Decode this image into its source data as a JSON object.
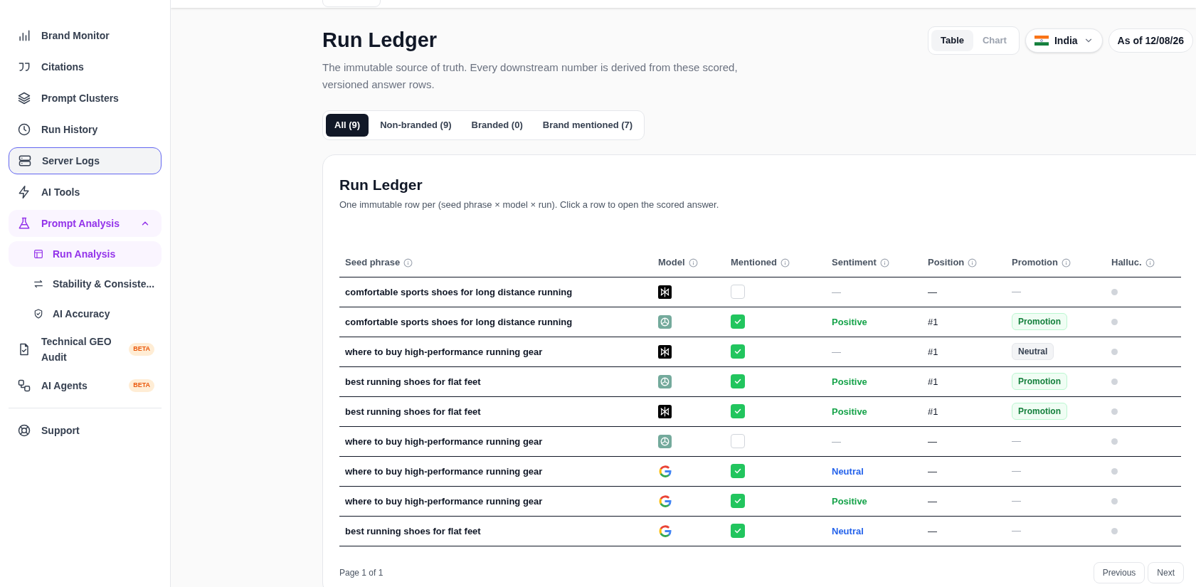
{
  "sidebar": {
    "items": [
      {
        "label": "Brand Monitor",
        "selected": false,
        "focused": false
      },
      {
        "label": "Citations",
        "selected": false,
        "focused": false
      },
      {
        "label": "Prompt Clusters",
        "selected": false,
        "focused": false
      },
      {
        "label": "Run History",
        "selected": false,
        "focused": false
      },
      {
        "label": "Server Logs",
        "selected": false,
        "focused": true
      },
      {
        "label": "AI Tools",
        "selected": false,
        "focused": false
      },
      {
        "label": "Prompt Analysis",
        "selected": true,
        "focused": false,
        "expanded": true,
        "children": [
          {
            "label": "Run Analysis",
            "selected": true
          },
          {
            "label": "Stability & Consiste...",
            "selected": false
          },
          {
            "label": "AI Accuracy",
            "selected": false
          }
        ]
      },
      {
        "label": "Technical GEO Audit",
        "selected": false,
        "focused": false,
        "badge": "BETA"
      },
      {
        "label": "AI Agents",
        "selected": false,
        "focused": false,
        "badge": "BETA"
      }
    ],
    "footer_items": [
      {
        "label": "Support"
      }
    ]
  },
  "header": {
    "title": "Run Ledger",
    "description": "The immutable source of truth. Every downstream number is derived from these scored, versioned answer rows.",
    "view_toggle": [
      {
        "label": "Table",
        "selected": true
      },
      {
        "label": "Chart",
        "selected": false
      }
    ],
    "country": "India",
    "as_of": "As of 12/08/26"
  },
  "filters": [
    {
      "label": "All (9)",
      "selected": true
    },
    {
      "label": "Non-branded (9)",
      "selected": false
    },
    {
      "label": "Branded (0)",
      "selected": false
    },
    {
      "label": "Brand mentioned (7)",
      "selected": false
    }
  ],
  "card": {
    "title": "Run Ledger",
    "subtitle": "One immutable row per (seed phrase × model × run). Click a row to open the scored answer.",
    "columns": [
      "Seed phrase",
      "Model",
      "Mentioned",
      "Sentiment",
      "Position",
      "Promotion",
      "Halluc."
    ],
    "rows": [
      {
        "seed": "comfortable sports shoes for long distance running",
        "kind": "dark",
        "mentioned": false,
        "sentiment": {
          "text": "—",
          "kind": "none"
        },
        "position": "—",
        "promotion": {
          "text": "—",
          "kind": "none"
        }
      },
      {
        "seed": "comfortable sports shoes for long distance running",
        "kind": "teal",
        "mentioned": true,
        "sentiment": {
          "text": "Positive",
          "kind": "positive"
        },
        "position": "#1",
        "promotion": {
          "text": "Promotion",
          "kind": "promotion"
        }
      },
      {
        "seed": "where to buy high-performance running gear",
        "kind": "dark",
        "mentioned": true,
        "sentiment": {
          "text": "—",
          "kind": "none"
        },
        "position": "#1",
        "promotion": {
          "text": "Neutral",
          "kind": "neutral"
        }
      },
      {
        "seed": "best running shoes for flat feet",
        "kind": "teal",
        "mentioned": true,
        "sentiment": {
          "text": "Positive",
          "kind": "positive"
        },
        "position": "#1",
        "promotion": {
          "text": "Promotion",
          "kind": "promotion"
        }
      },
      {
        "seed": "best running shoes for flat feet",
        "kind": "dark",
        "mentioned": true,
        "sentiment": {
          "text": "Positive",
          "kind": "positive"
        },
        "position": "#1",
        "promotion": {
          "text": "Promotion",
          "kind": "promotion"
        }
      },
      {
        "seed": "where to buy high-performance running gear",
        "kind": "teal",
        "mentioned": false,
        "sentiment": {
          "text": "—",
          "kind": "none"
        },
        "position": "—",
        "promotion": {
          "text": "—",
          "kind": "none"
        }
      },
      {
        "seed": "where to buy high-performance running gear",
        "kind": "g",
        "mentioned": true,
        "sentiment": {
          "text": "Neutral",
          "kind": "neutral"
        },
        "position": "—",
        "promotion": {
          "text": "—",
          "kind": "none"
        }
      },
      {
        "seed": "where to buy high-performance running gear",
        "kind": "g",
        "mentioned": true,
        "sentiment": {
          "text": "Positive",
          "kind": "positive"
        },
        "position": "—",
        "promotion": {
          "text": "—",
          "kind": "none"
        }
      },
      {
        "seed": "best running shoes for flat feet",
        "kind": "g",
        "mentioned": true,
        "sentiment": {
          "text": "Neutral",
          "kind": "neutral"
        },
        "position": "—",
        "promotion": {
          "text": "—",
          "kind": "none"
        }
      }
    ],
    "pagination": {
      "label": "Page 1 of 1",
      "buttons": [
        "Previous",
        "Next"
      ]
    }
  }
}
